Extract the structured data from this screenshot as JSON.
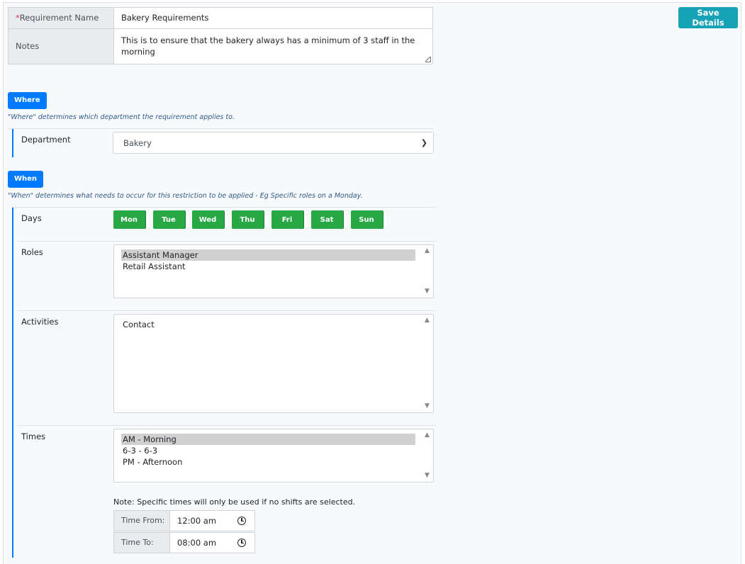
{
  "header": {
    "requirement_name_label": "Requirement Name",
    "requirement_name_value": "Bakery Requirements",
    "notes_label": "Notes",
    "notes_value": "This is to ensure that the bakery always has a minimum of 3 staff in the morning",
    "save_label": "Save Details"
  },
  "where": {
    "badge": "Where",
    "note": "\"Where\" determines which department the requirement applies to.",
    "department_label": "Department",
    "department_value": "Bakery"
  },
  "when": {
    "badge": "When",
    "note": "\"When\" determines what needs to occur for this restriction to be applied - Eg Specific roles on a Monday.",
    "days_label": "Days",
    "days": [
      "Mon",
      "Tue",
      "Wed",
      "Thu",
      "Fri",
      "Sat",
      "Sun"
    ],
    "roles_label": "Roles",
    "roles": [
      "Assistant Manager",
      "Retail Assistant"
    ],
    "activities_label": "Activities",
    "activities": [
      "Contact"
    ],
    "times_label": "Times",
    "times": [
      "AM - Morning",
      "6-3 - 6-3",
      "PM - Afternoon"
    ],
    "times_note": "Note: Specific times will only be used if no shifts are selected.",
    "time_from_label": "Time From:",
    "time_from_value": "12:00 am",
    "time_to_label": "Time To:",
    "time_to_value": "08:00 am"
  },
  "colors": {
    "primary": "#007bff",
    "success": "#28a745",
    "info": "#17a2b8"
  }
}
